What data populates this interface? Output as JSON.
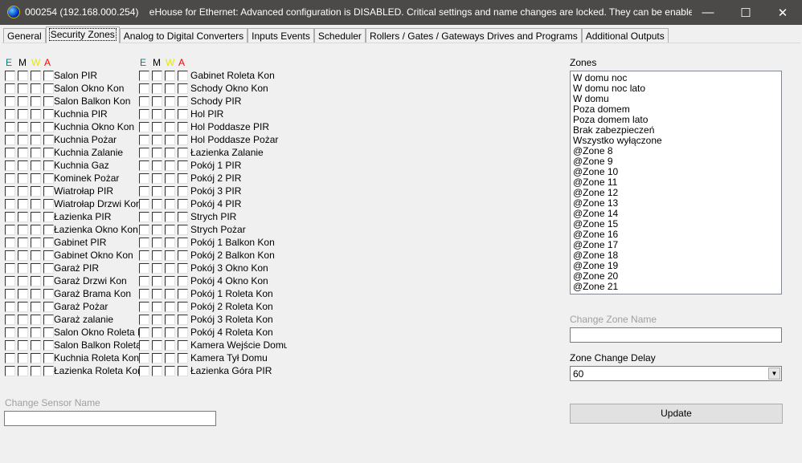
{
  "window": {
    "title": "000254 (192.168.000.254)    eHouse for Ethernet: Advanced configuration is DISABLED. Critical settings and name changes are locked. They can be enabled a...",
    "minimize": "—",
    "maximize": "☐",
    "close": "✕"
  },
  "tabs": [
    {
      "label": "General"
    },
    {
      "label": "Security Zones",
      "active": true
    },
    {
      "label": "Analog to Digital Converters"
    },
    {
      "label": "Inputs Events"
    },
    {
      "label": "Scheduler"
    },
    {
      "label": "Rollers / Gates / Gateways Drives  and Programs"
    },
    {
      "label": "Additional Outputs"
    }
  ],
  "headers": [
    {
      "label": "E",
      "color": "#008080"
    },
    {
      "label": "M",
      "color": "#000000"
    },
    {
      "label": "W",
      "color": "#e8e800"
    },
    {
      "label": "A",
      "color": "#ff0000"
    }
  ],
  "sensors_col1": [
    "Salon PIR",
    "Salon Okno Kon",
    "Salon Balkon Kon",
    "Kuchnia PIR",
    "Kuchnia Okno Kon",
    "Kuchnia Pożar",
    "Kuchnia Zalanie",
    "Kuchnia Gaz",
    "Kominek Pożar",
    "Wiatrołap PIR",
    "Wiatrołap Drzwi Kon",
    "Łazienka PIR",
    "Łazienka Okno Kon",
    "Gabinet PIR",
    "Gabinet Okno Kon",
    "Garaż PIR",
    "Garaż Drzwi Kon",
    "Garaż Brama Kon",
    "Garaż Pożar",
    "Garaż zalanie",
    "Salon Okno Roleta Kon",
    "Salon Balkon Roleta Kon",
    "Kuchnia Roleta Kon",
    "Łazienka Roleta Kon"
  ],
  "sensors_col2": [
    "Gabinet Roleta Kon",
    "Schody Okno Kon",
    "Schody PIR",
    "Hol PIR",
    "Hol Poddasze PIR",
    "Hol Poddasze Pożar",
    "Łazienka Zalanie",
    "Pokój 1 PIR",
    "Pokój 2 PIR",
    "Pokój 3 PIR",
    "Pokój 4 PIR",
    "Strych PIR",
    "Strych Pożar",
    "Pokój 1 Balkon Kon",
    "Pokój 2 Balkon Kon",
    "Pokój 3 Okno Kon",
    "Pokój 4 Okno Kon",
    "Pokój 1 Roleta Kon",
    "Pokój 2 Roleta Kon",
    "Pokój 3 Roleta Kon",
    "Pokój 4 Roleta Kon",
    "Kamera Wejście Domu",
    "Kamera Tył Domu",
    "Łazienka Góra PIR"
  ],
  "change_sensor_name": {
    "label": "Change Sensor Name",
    "value": ""
  },
  "zones": {
    "label": "Zones",
    "items": [
      "W domu noc",
      "W domu noc lato",
      "W domu",
      "Poza domem",
      "Poza domem lato",
      "Brak zabezpieczeń",
      "Wszystko wyłączone",
      "@Zone 8",
      "@Zone 9",
      "@Zone 10",
      "@Zone 11",
      "@Zone 12",
      "@Zone 13",
      "@Zone 14",
      "@Zone 15",
      "@Zone 16",
      "@Zone 17",
      "@Zone 18",
      "@Zone 19",
      "@Zone 20",
      "@Zone 21"
    ]
  },
  "change_zone_name": {
    "label": "Change Zone Name",
    "value": ""
  },
  "zone_change_delay": {
    "label": "Zone Change Delay",
    "value": "60"
  },
  "update_label": "Update"
}
